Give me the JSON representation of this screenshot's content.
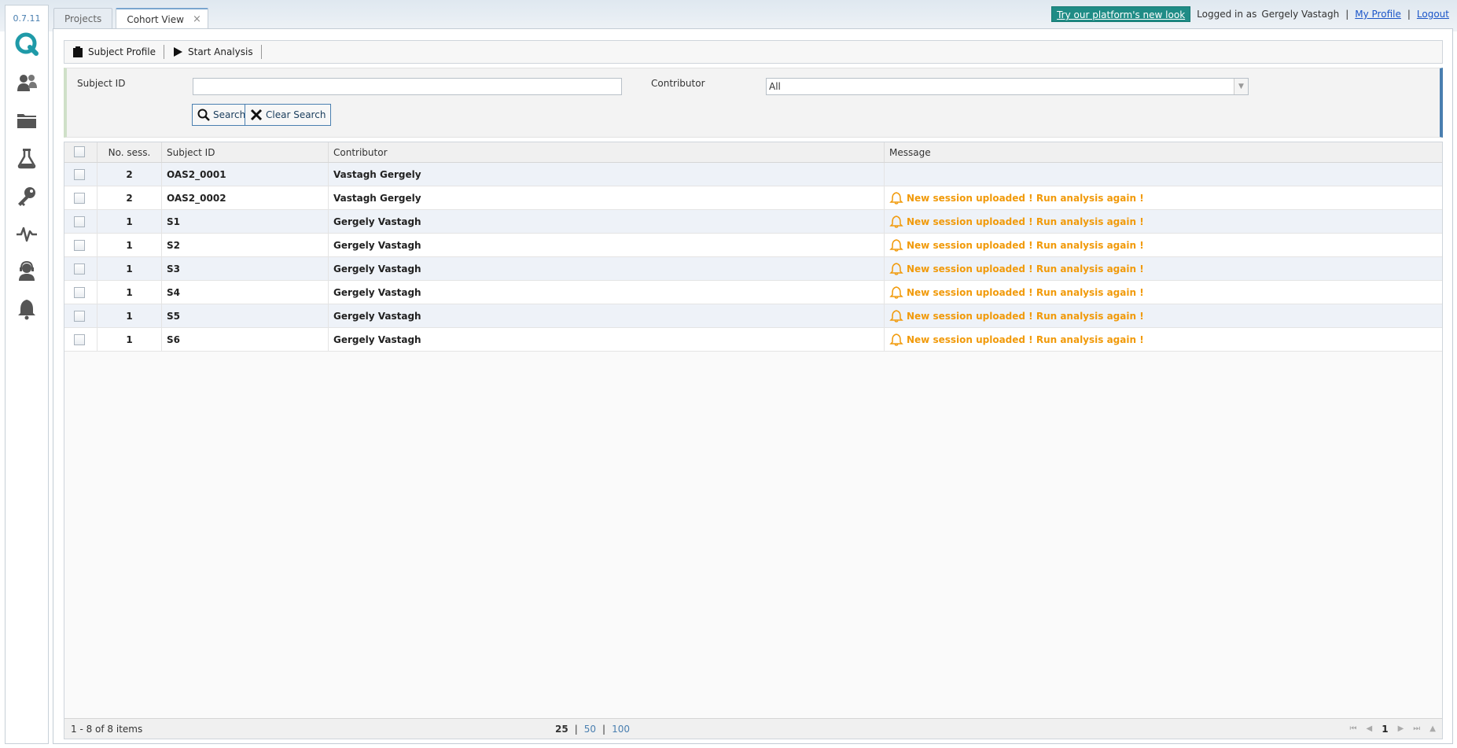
{
  "app": {
    "version": "0.7.11"
  },
  "rail": {
    "items": [
      "subjects-icon",
      "folder-icon",
      "flask-icon",
      "key-icon",
      "activity-icon",
      "support-icon",
      "bell-icon"
    ]
  },
  "tabs": [
    {
      "label": "Projects"
    },
    {
      "label": "Cohort View",
      "close": "×"
    }
  ],
  "header": {
    "new_look": "Try our platform's new look",
    "logged_in_prefix": "Logged in as",
    "user_name": "Gergely Vastagh",
    "sep": "|",
    "my_profile": "My Profile",
    "logout": "Logout"
  },
  "toolbar": {
    "subject_profile": "Subject Profile",
    "start_analysis": "Start Analysis"
  },
  "search": {
    "subject_id_label": "Subject ID",
    "subject_id_value": "",
    "contributor_label": "Contributor",
    "contributor_value": "All",
    "search_btn": "Search",
    "clear_btn": "Clear Search"
  },
  "grid": {
    "columns": {
      "sessions": "No. sess.",
      "subject_id": "Subject ID",
      "contributor": "Contributor",
      "message": "Message"
    },
    "rows": [
      {
        "sessions": "2",
        "subject_id": "OAS2_0001",
        "contributor": "Vastagh Gergely",
        "message": ""
      },
      {
        "sessions": "2",
        "subject_id": "OAS2_0002",
        "contributor": "Vastagh Gergely",
        "message": "New session uploaded ! Run analysis again !"
      },
      {
        "sessions": "1",
        "subject_id": "S1",
        "contributor": "Gergely Vastagh",
        "message": "New session uploaded ! Run analysis again !"
      },
      {
        "sessions": "1",
        "subject_id": "S2",
        "contributor": "Gergely Vastagh",
        "message": "New session uploaded ! Run analysis again !"
      },
      {
        "sessions": "1",
        "subject_id": "S3",
        "contributor": "Gergely Vastagh",
        "message": "New session uploaded ! Run analysis again !"
      },
      {
        "sessions": "1",
        "subject_id": "S4",
        "contributor": "Gergely Vastagh",
        "message": "New session uploaded ! Run analysis again !"
      },
      {
        "sessions": "1",
        "subject_id": "S5",
        "contributor": "Gergely Vastagh",
        "message": "New session uploaded ! Run analysis again !"
      },
      {
        "sessions": "1",
        "subject_id": "S6",
        "contributor": "Gergely Vastagh",
        "message": "New session uploaded ! Run analysis again !"
      }
    ]
  },
  "pager": {
    "summary": "1 - 8 of 8 items",
    "page_sizes": [
      "25",
      "50",
      "100"
    ],
    "current_size": "25",
    "sep": "|",
    "current_page": "1"
  },
  "colors": {
    "accent": "#4a7fb0",
    "warning": "#f19a0a",
    "new_look_bg": "#1f8c86"
  }
}
